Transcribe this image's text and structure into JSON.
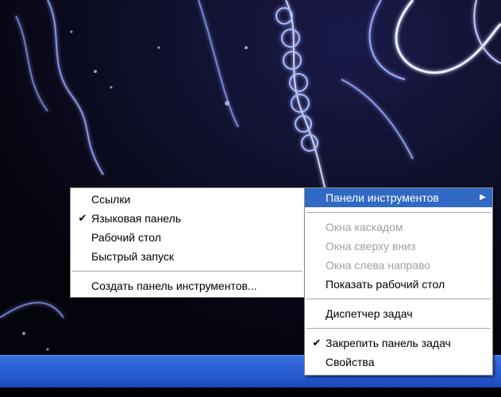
{
  "context_menu": {
    "submenu_items": [
      {
        "label": "Ссылки",
        "checked": false
      },
      {
        "label": "Языковая панель",
        "checked": true
      },
      {
        "label": "Рабочий стол",
        "checked": false
      },
      {
        "label": "Быстрый запуск",
        "checked": false
      }
    ],
    "create_toolbar_label": "Создать панель инструментов...",
    "toolbars_label": "Панели инструментов",
    "cascade_label": "Окна каскадом",
    "tile_horizontal_label": "Окна сверху вниз",
    "tile_vertical_label": "Окна слева направо",
    "show_desktop_label": "Показать рабочий стол",
    "task_manager_label": "Диспетчер задач",
    "lock_taskbar_label": "Закрепить панель задач",
    "lock_taskbar_checked": true,
    "properties_label": "Свойства"
  },
  "colors": {
    "highlight": "#316ac5",
    "taskbar": "#2f63d8",
    "disabled_text": "#a0a0a0"
  }
}
